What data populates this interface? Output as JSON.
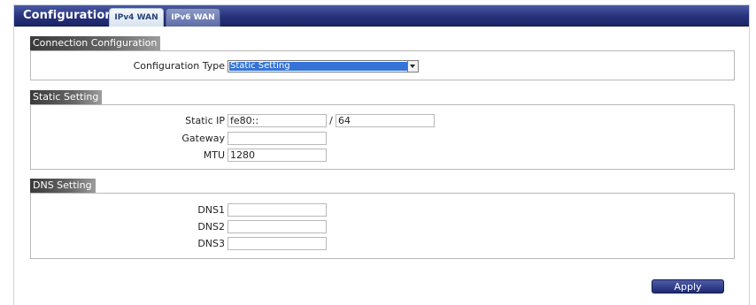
{
  "header": {
    "title": "Configuration",
    "tabs": [
      {
        "label": "IPv4 WAN",
        "active": true
      },
      {
        "label": "IPv6 WAN",
        "active": false
      }
    ],
    "bar_color": "#26317a"
  },
  "connection": {
    "section_label": "Connection Configuration",
    "type_label": "Configuration Type",
    "type_value": "Static Setting"
  },
  "static": {
    "section_label": "Static Setting",
    "ip_label": "Static IP",
    "ip_value": "fe80::",
    "prefix_separator": "/",
    "prefix_value": "64",
    "gateway_label": "Gateway",
    "gateway_value": "",
    "mtu_label": "MTU",
    "mtu_value": "1280"
  },
  "dns": {
    "section_label": "DNS Setting",
    "dns1_label": "DNS1",
    "dns1_value": "",
    "dns2_label": "DNS2",
    "dns2_value": "",
    "dns3_label": "DNS3",
    "dns3_value": ""
  },
  "actions": {
    "apply_label": "Apply"
  }
}
